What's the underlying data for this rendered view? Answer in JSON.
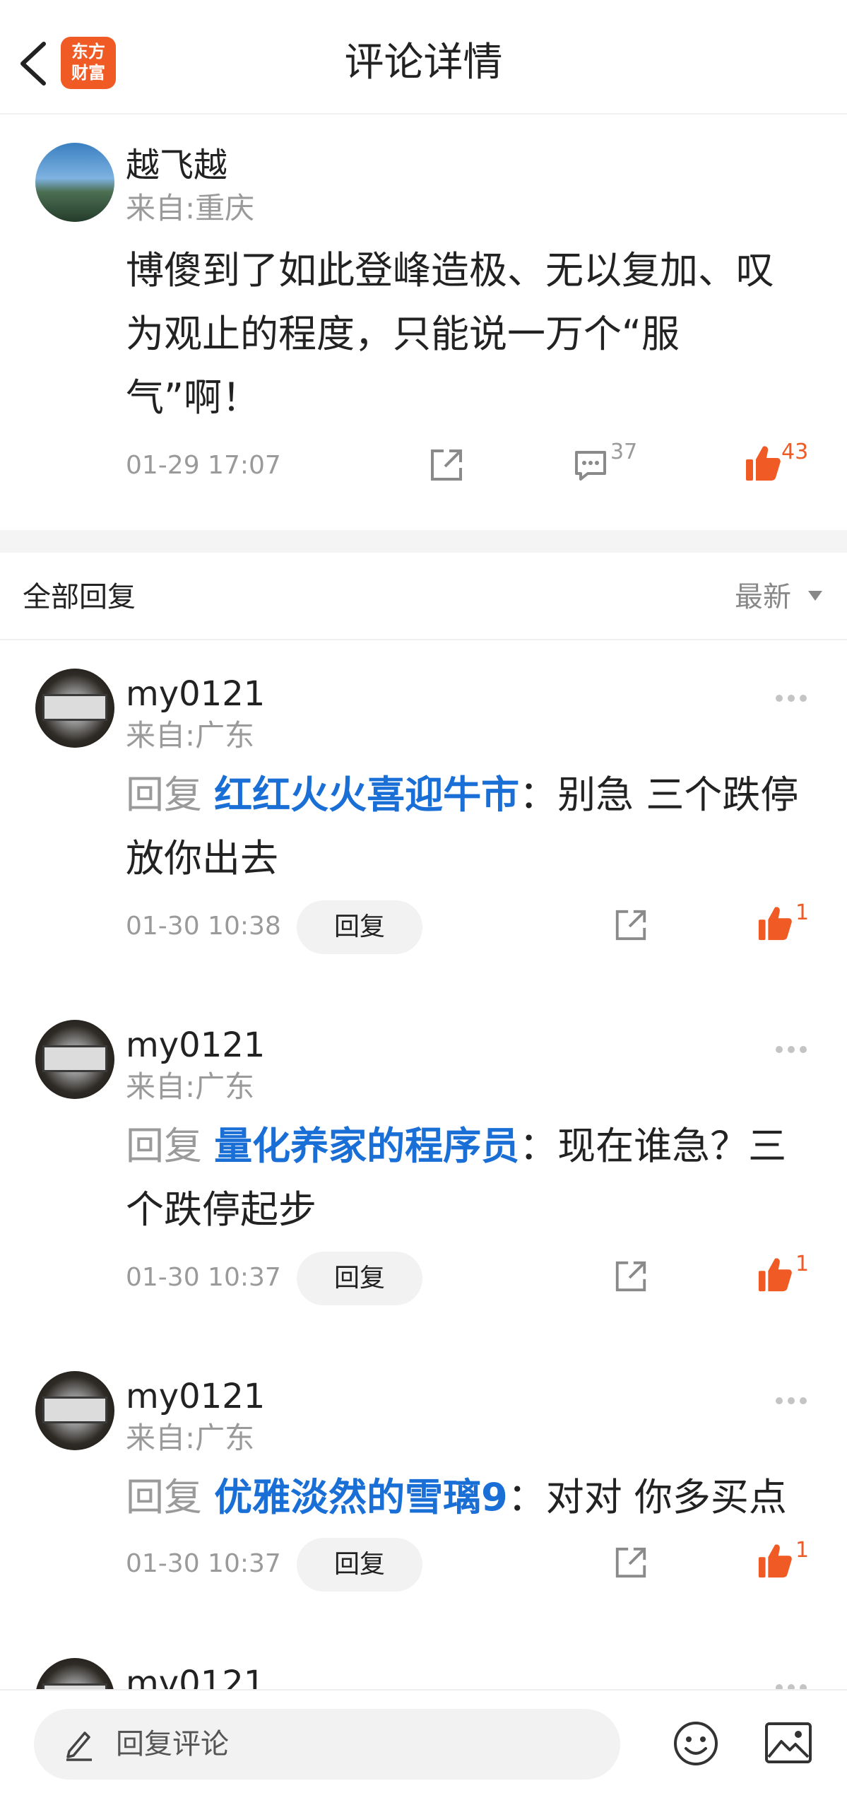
{
  "header": {
    "title": "评论详情",
    "logo_line1": "东方",
    "logo_line2": "财富"
  },
  "main_comment": {
    "author": "越飞越",
    "location": "来自:重庆",
    "text": "博傻到了如此登峰造极、无以复加、叹为观止的程度，只能说一万个“服气”啊！",
    "time": "01-29 17:07",
    "comment_count": "37",
    "like_count": "43"
  },
  "replies_header": {
    "title": "全部回复",
    "sort": "最新"
  },
  "replies": [
    {
      "author": "my0121",
      "location": "来自:广东",
      "prefix": "回复 ",
      "target": "红红火火喜迎牛市",
      "text": "：别急  三个跌停放你出去",
      "time": "01-30 10:38",
      "reply_label": "回复",
      "likes": "1"
    },
    {
      "author": "my0121",
      "location": "来自:广东",
      "prefix": "回复 ",
      "target": "量化养家的程序员",
      "text": "：现在谁急？三个跌停起步",
      "time": "01-30 10:37",
      "reply_label": "回复",
      "likes": "1"
    },
    {
      "author": "my0121",
      "location": "来自:广东",
      "prefix": "回复 ",
      "target": "优雅淡然的雪璃9",
      "text": "：对对 你多买点",
      "time": "01-30 10:37",
      "reply_label": "回复",
      "likes": "1"
    },
    {
      "author": "my0121"
    }
  ],
  "bottom_bar": {
    "placeholder": "回复评论"
  },
  "colors": {
    "accent_orange": "#f05a24",
    "link_blue": "#1a6fd6",
    "muted_gray": "#9a9a9a"
  },
  "icons": [
    "back-arrow-icon",
    "share-icon",
    "comment-icon",
    "thumbs-up-icon",
    "more-dots-icon",
    "pencil-icon",
    "emoji-icon",
    "image-icon"
  ]
}
